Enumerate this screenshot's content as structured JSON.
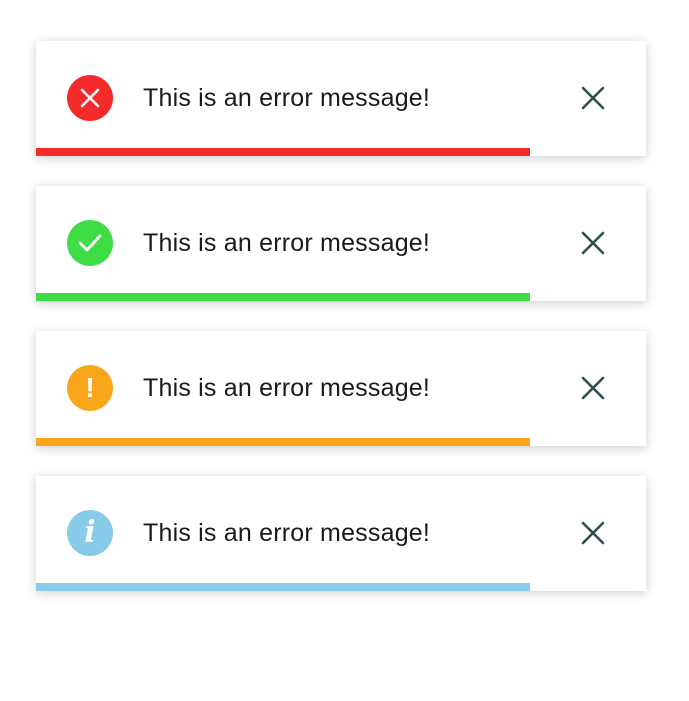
{
  "toasts": [
    {
      "type": "error",
      "message": "This is an error message!",
      "icon": "x-circle-icon",
      "color": "#f52b2b",
      "progress": 0.81
    },
    {
      "type": "success",
      "message": "This is an error message!",
      "icon": "check-circle-icon",
      "color": "#3fdd45",
      "progress": 0.81
    },
    {
      "type": "warning",
      "message": "This is an error message!",
      "icon": "exclamation-circle-icon",
      "color": "#f9a61d",
      "progress": 0.81
    },
    {
      "type": "info",
      "message": "This is an error message!",
      "icon": "info-circle-icon",
      "color": "#86cbe8",
      "progress": 0.81
    }
  ],
  "close_icon": "close-icon",
  "close_color": "#2f4f4f",
  "info_glyph": "i",
  "warning_glyph": "!"
}
